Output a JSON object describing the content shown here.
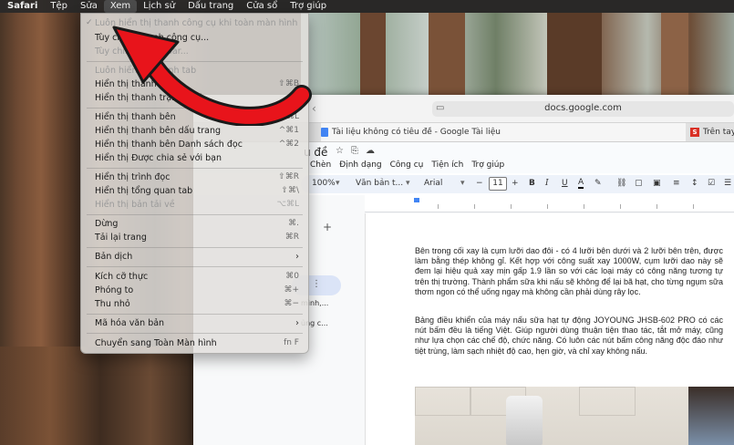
{
  "menubar": {
    "items": [
      "Safari",
      "Tệp",
      "Sửa",
      "Xem",
      "Lịch sử",
      "Dấu trang",
      "Cửa sổ",
      "Trợ giúp"
    ],
    "active_index": 3
  },
  "view_menu": {
    "items": [
      {
        "label": "Luôn hiển thị thanh công cụ khi toàn màn hình",
        "shortcut": "",
        "disabled": true,
        "checked": true
      },
      {
        "label": "Tùy chỉnh thanh công cụ...",
        "shortcut": "",
        "disabled": false
      },
      {
        "label": "Tùy chỉnh Touch Bar...",
        "shortcut": "",
        "disabled": true
      },
      {
        "label": "Luôn hiển thị thanh tab",
        "shortcut": "",
        "disabled": true
      },
      {
        "label": "Hiển thị thanh tab",
        "shortcut": "⇧⌘B",
        "disabled": false
      },
      {
        "label": "Hiển thị thanh trạng thái",
        "shortcut": "⌘/",
        "disabled": false
      },
      {
        "label": "Hiển thị thanh bên",
        "shortcut": "⇧⌘L",
        "disabled": false
      },
      {
        "label": "Hiển thị thanh bên dấu trang",
        "shortcut": "^⌘1",
        "disabled": false
      },
      {
        "label": "Hiển thị thanh bên Danh sách đọc",
        "shortcut": "^⌘2",
        "disabled": false
      },
      {
        "label": "Hiển thị Được chia sẻ với bạn",
        "shortcut": "",
        "disabled": false
      },
      {
        "label": "Hiển thị trình đọc",
        "shortcut": "⇧⌘R",
        "disabled": false
      },
      {
        "label": "Hiển thị tổng quan tab",
        "shortcut": "⇧⌘\\",
        "disabled": false
      },
      {
        "label": "Hiển thị bản tải về",
        "shortcut": "⌥⌘L",
        "disabled": true
      },
      {
        "label": "Dừng",
        "shortcut": "⌘.",
        "disabled": false
      },
      {
        "label": "Tải lại trang",
        "shortcut": "⌘R",
        "disabled": false
      },
      {
        "label": "Bản dịch",
        "shortcut": "",
        "submenu": true,
        "disabled": false
      },
      {
        "label": "Kích cỡ thực",
        "shortcut": "⌘0",
        "disabled": false
      },
      {
        "label": "Phóng to",
        "shortcut": "⌘+",
        "disabled": false
      },
      {
        "label": "Thu nhỏ",
        "shortcut": "⌘−",
        "disabled": false
      },
      {
        "label": "Mã hóa văn bản",
        "shortcut": "",
        "submenu": true,
        "disabled": false
      },
      {
        "label": "Chuyển sang Toàn Màn hình",
        "shortcut": "fn F",
        "disabled": false
      }
    ]
  },
  "browser": {
    "url": "docs.google.com",
    "tabs": [
      {
        "label": "Tài liệu không có tiêu đề - Google Tài liệu"
      },
      {
        "label": "Trên tay J"
      }
    ],
    "docs": {
      "title": "u đề",
      "menus": [
        "Chèn",
        "Định dạng",
        "Công cụ",
        "Tiện ích",
        "Trợ giúp"
      ],
      "toolbar": {
        "zoom": "100%",
        "style": "Văn bản t...",
        "font": "Arial",
        "font_size": "11",
        "bold": "B",
        "italic": "I",
        "underline": "U",
        "text_color": "A"
      },
      "outline": {
        "line1": "mình,...",
        "line2": "ủng c..."
      },
      "paragraphs": [
        "Bên trong cối xay là cụm lưỡi dao đôi - có 4 lưỡi bên dưới và 2 lưỡi bên trên, được làm bằng thép không gỉ. Kết hợp với công suất xay 1000W, cụm lưỡi dao này sẽ đem lại hiệu quả xay mịn gấp 1.9 lần so với các loại máy có công năng tương tự trên thị trường. Thành phẩm sữa khi nấu sẽ không để lại bã hạt, cho từng ngụm sữa thơm ngon có thể uống ngay mà không cần phải dùng rây lọc.",
        "Bảng điều khiển của máy nấu sữa hạt tự động JOYOUNG JHSB-602 PRO có các nút bấm đều là tiếng Việt. Giúp người dùng thuận tiện thao tác, tắt mở máy, cũng như lựa chọn các chế độ, chức năng. Có luôn các nút bấm công năng độc đáo như tiệt trùng, làm sạch nhiệt độ cao, hẹn giờ, và chỉ xay không nấu."
      ]
    }
  },
  "colors": {
    "annotation_arrow": "#e8141b",
    "menubar_bg": "#282828",
    "docs_blue": "#4285f4"
  }
}
